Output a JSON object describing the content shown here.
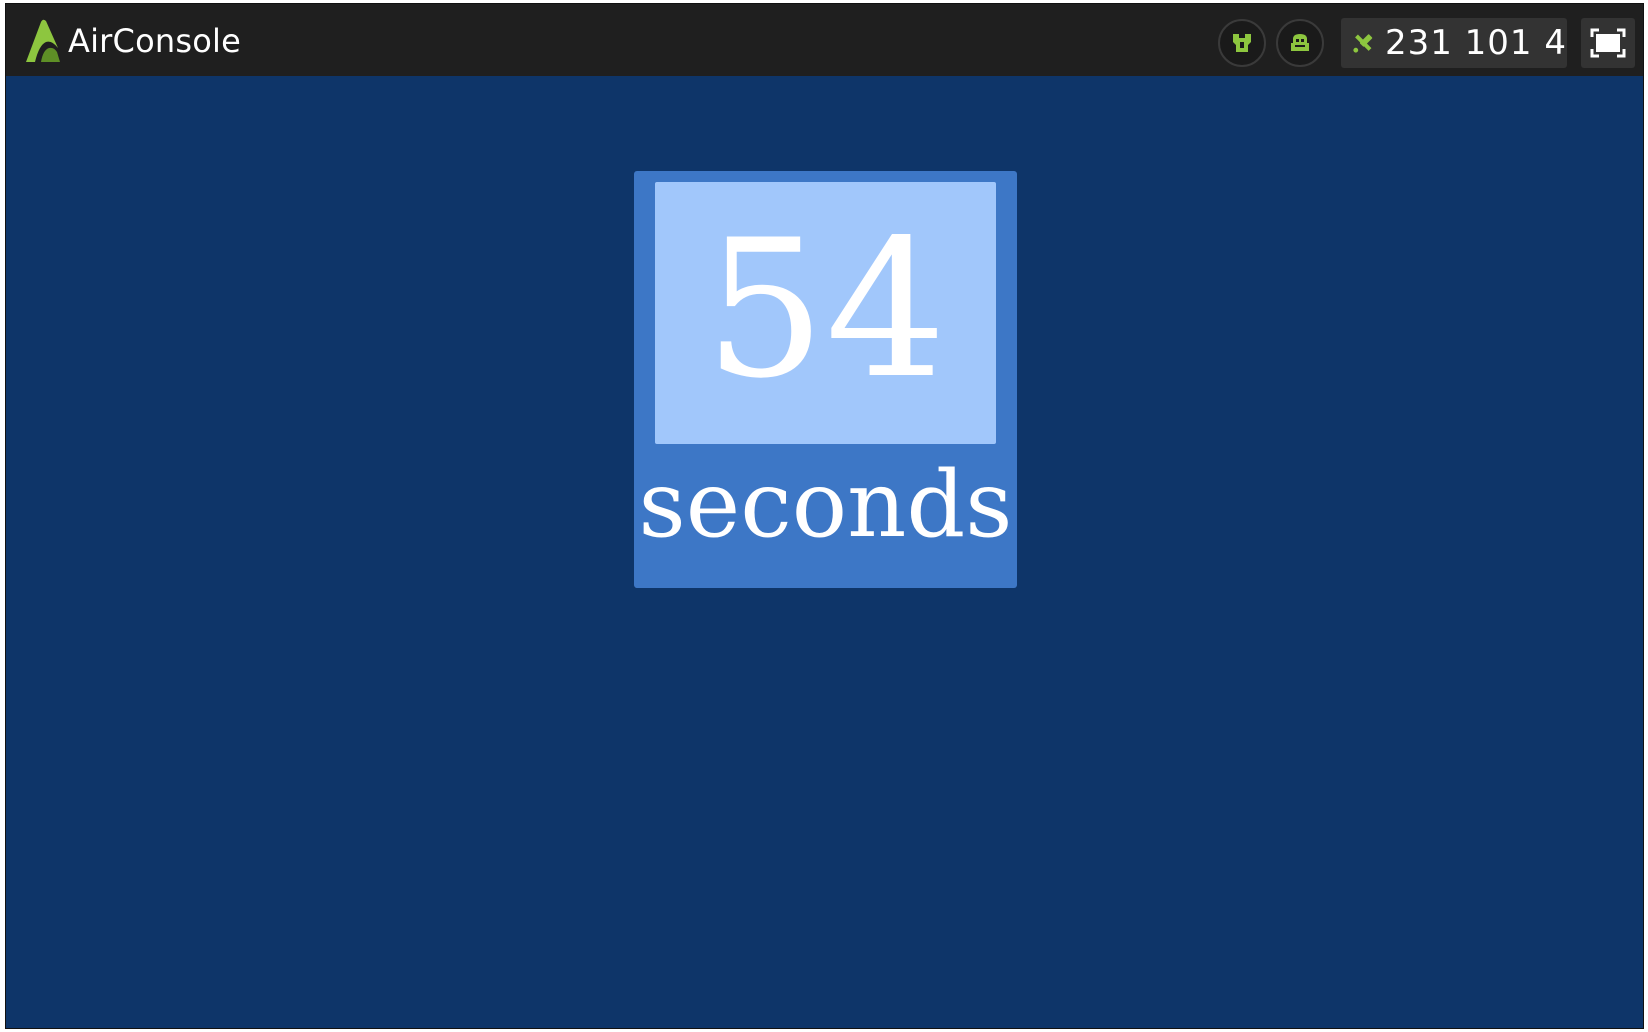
{
  "header": {
    "brand_name": "AirConsole",
    "connection_code": "231 101 4",
    "icons": {
      "logo": "airconsole-logo-icon",
      "controller": "controller-icon",
      "players": "players-icon",
      "code": "satellite-icon",
      "fullscreen": "fullscreen-icon"
    },
    "accent_color": "#8dc63f"
  },
  "game": {
    "timer_value": "54",
    "timer_unit": "seconds",
    "colors": {
      "background": "#0e3569",
      "panel": "#3d77c6",
      "panel_inner": "#a1c7fb"
    }
  }
}
